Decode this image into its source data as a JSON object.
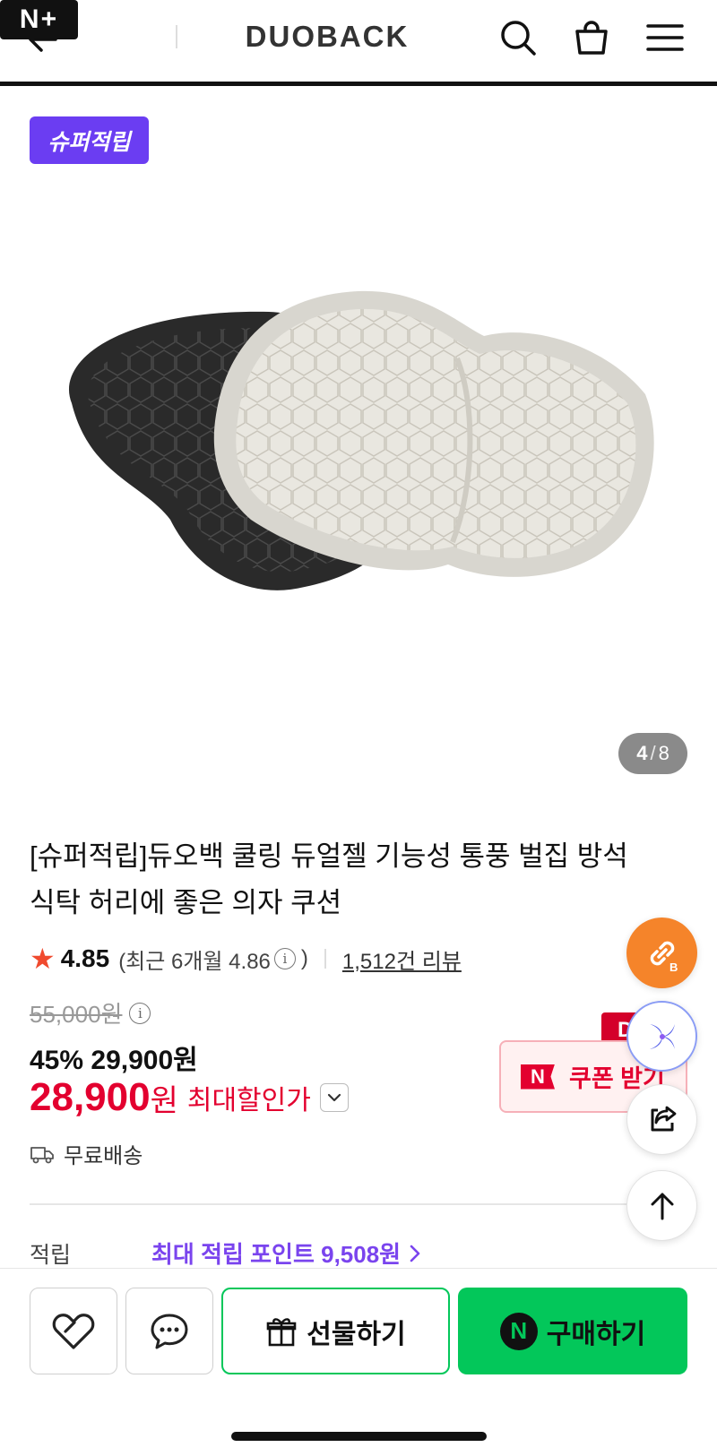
{
  "header": {
    "back_label": "←",
    "nplus_label": "N+",
    "logo": "DUOBACK"
  },
  "gallery": {
    "badge": "슈퍼적립",
    "current": "4",
    "separator": "/",
    "total": "8"
  },
  "product": {
    "title": "[슈퍼적립]듀오백 쿨링 듀얼젤 기능성 통풍 벌집 방석 식탁 허리에 좋은 의자 쿠션",
    "rating": "4.85",
    "recent_rating": "(최근 6개월 4.86",
    "recent_rating_close": ")",
    "review_link": "1,512건 리뷰",
    "original_price": "55,000원",
    "discount_line": "45% 29,900원",
    "final_price": "28,900",
    "final_currency": "원",
    "max_discount_label": "최대할인가",
    "shipping": "무료배송",
    "point_label": "적립",
    "point_value": "최대 적립 포인트 9,508원"
  },
  "coupon": {
    "tag": "D",
    "icon_letter": "N",
    "label": "쿠폰 받기"
  },
  "bottom_bar": {
    "gift_label": "선물하기",
    "buy_label": "구매하기",
    "npay_letter": "N"
  },
  "colors": {
    "badge": "#6b3df2",
    "price_red": "#e3002f",
    "naver_green": "#03c75a",
    "point_purple": "#7a44ee",
    "link_orange": "#f5842a"
  }
}
